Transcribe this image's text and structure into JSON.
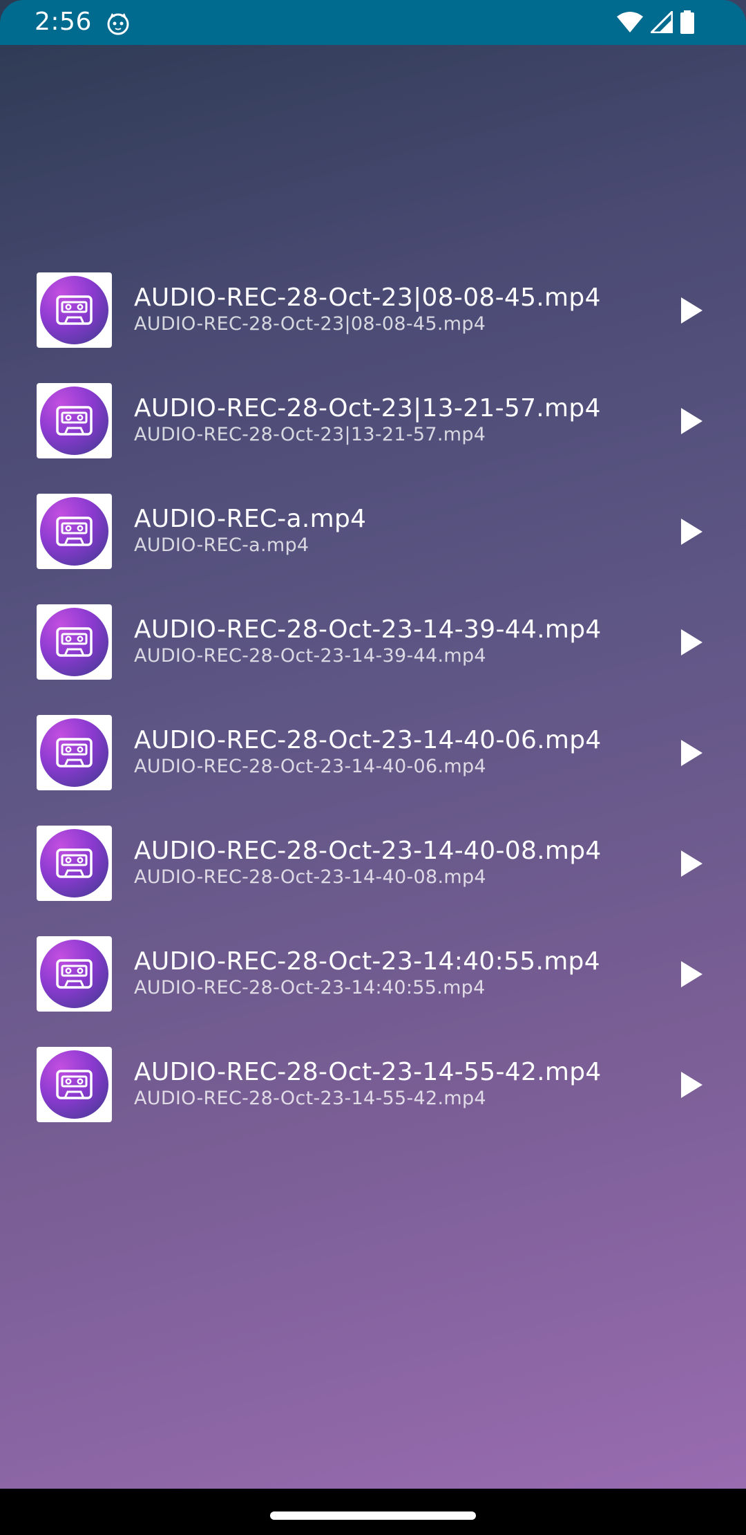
{
  "status_bar": {
    "time": "2:56",
    "background": "#006a8f",
    "icons": [
      "cat-notification-icon",
      "wifi-icon",
      "signal-icon",
      "battery-icon"
    ]
  },
  "recordings": [
    {
      "title": "AUDIO-REC-28-Oct-23|08-08-45.mp4",
      "subtitle": "AUDIO-REC-28-Oct-23|08-08-45.mp4"
    },
    {
      "title": "AUDIO-REC-28-Oct-23|13-21-57.mp4",
      "subtitle": "AUDIO-REC-28-Oct-23|13-21-57.mp4"
    },
    {
      "title": "AUDIO-REC-a.mp4",
      "subtitle": "AUDIO-REC-a.mp4"
    },
    {
      "title": "AUDIO-REC-28-Oct-23-14-39-44.mp4",
      "subtitle": "AUDIO-REC-28-Oct-23-14-39-44.mp4"
    },
    {
      "title": "AUDIO-REC-28-Oct-23-14-40-06.mp4",
      "subtitle": "AUDIO-REC-28-Oct-23-14-40-06.mp4"
    },
    {
      "title": "AUDIO-REC-28-Oct-23-14-40-08.mp4",
      "subtitle": "AUDIO-REC-28-Oct-23-14-40-08.mp4"
    },
    {
      "title": "AUDIO-REC-28-Oct-23-14:40:55.mp4",
      "subtitle": "AUDIO-REC-28-Oct-23-14:40:55.mp4"
    },
    {
      "title": "AUDIO-REC-28-Oct-23-14-55-42.mp4",
      "subtitle": "AUDIO-REC-28-Oct-23-14-55-42.mp4"
    }
  ],
  "item_icon": "cassette-icon",
  "action_icon": "play-icon"
}
